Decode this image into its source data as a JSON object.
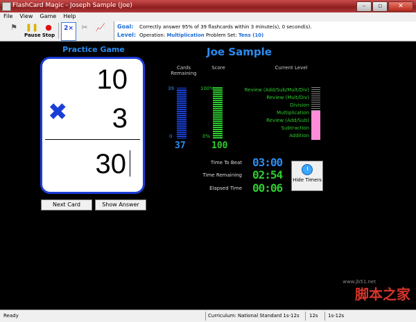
{
  "window": {
    "title": "FlashCard Magic - Joseph  Sample (Joe)"
  },
  "menu": [
    "File",
    "View",
    "Game",
    "Help"
  ],
  "toolbar": {
    "pause_label": "Pause",
    "stop_label": "Stop"
  },
  "goal": {
    "goal_label": "Goal:",
    "goal_text": "Correctly answer 95% of 39 flashcards within 3 minute(s), 0 second(s).",
    "level_label": "Level:",
    "operation_label": "Operation:",
    "operation_value": "Multiplication",
    "problem_set_label": "Problem Set:",
    "problem_set_value": "Tens (10)"
  },
  "game": {
    "title": "Practice Game",
    "top_number": "10",
    "bottom_number": "3",
    "operator": "✖",
    "answer": "30",
    "next_card_label": "Next Card",
    "show_answer_label": "Show Answer"
  },
  "student": {
    "name": "Joe Sample"
  },
  "stats": {
    "cards_header": "Cards\nRemaining",
    "score_header": "Score",
    "level_header": "Current Level",
    "cards_max": "39",
    "cards_min": "0",
    "cards_value": "37",
    "cards_fraction": 0.95,
    "score_max": "100%",
    "score_min": "0%",
    "score_value": "100",
    "score_fraction": 1.0,
    "levels": [
      "Review (Add/Sub/Mult/Div)",
      "Review (Mult/Div)",
      "Division",
      "Multiplication",
      "Review (Add/Sub)",
      "Subtraction",
      "Addition"
    ],
    "level_fraction": 0.55
  },
  "timers": {
    "time_to_beat_label": "Time To Beat",
    "time_to_beat": "03:00",
    "time_remaining_label": "Time Remaining",
    "time_remaining": "02:54",
    "elapsed_label": "Elapsed Time",
    "elapsed": "00:06",
    "hide_timers_label": "Hide Timers"
  },
  "watermark": {
    "cn": "脚本之家",
    "url": "www.jb51.net"
  },
  "status": {
    "ready": "Ready",
    "curriculum": "Curriculum: National Standard 1s-12s",
    "set": "12s",
    "range": "1s-12s"
  },
  "colors": {
    "accent_blue": "#2b8cf0",
    "bar_blue": "#1a3fd6",
    "bar_green": "#2ecc2e",
    "level_pink": "#ff8cd8"
  }
}
